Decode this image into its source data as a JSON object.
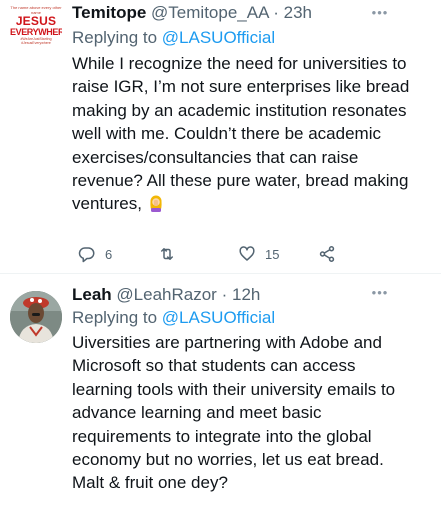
{
  "tweets": [
    {
      "name": "Temitope",
      "handle": "@Temitope_AA",
      "dot": "·",
      "time": "23h",
      "reply_prefix": "Replying to ",
      "reply_to": "@LASUOfficial",
      "text": "While I recognize the need for universities to raise IGR, I’m not sure enterprises like bread making by an academic institution resonates well with me. Couldn’t there be academic exercises/consultancies that can raise revenue? All these pure water, bread making ventures, ",
      "avatar": {
        "top_small": "The name above every other name",
        "word1": "JESUS",
        "word2": "EVERYWHERE",
        "bottom_small": "#WeAreJustStarting #JesusEverywhere"
      },
      "replies": "6",
      "retweets": "",
      "likes": "15",
      "emoji_name": "woman-facepalming-emoji"
    },
    {
      "name": "Leah",
      "handle": "@LeahRazor",
      "dot": "·",
      "time": "12h",
      "reply_prefix": "Replying to ",
      "reply_to": "@LASUOfficial",
      "text": "Uiversities are partnering with Adobe and Microsoft so that students can access learning tools with their university emails to advance learning and meet basic requirements to integrate into the global economy but no worries, let us eat bread. Malt & fruit one dey?"
    }
  ],
  "colors": {
    "text": "#0f1419",
    "secondary": "#536471",
    "link": "#1d9bf0",
    "divider": "#eff3f4",
    "jesus_red": "#d0141a"
  },
  "icons": [
    "reply-icon",
    "retweet-icon",
    "like-icon",
    "share-icon",
    "more-icon"
  ]
}
